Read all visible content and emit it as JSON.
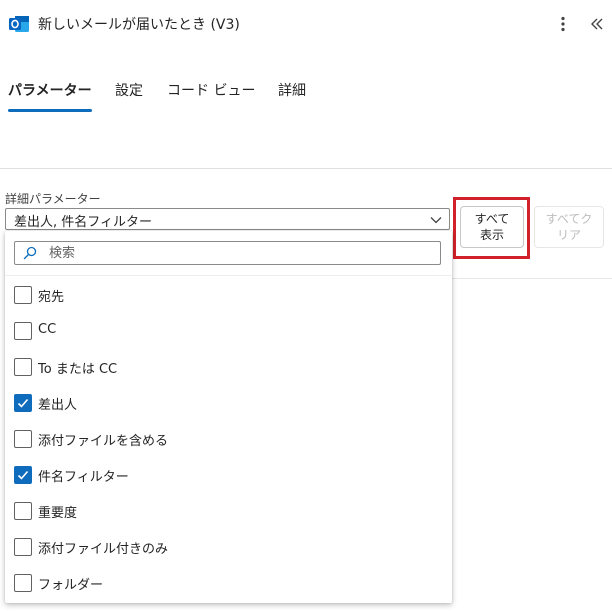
{
  "header": {
    "title": "新しいメールが届いたとき (V3)",
    "app_icon": "outlook-icon",
    "more_icon": "more-vertical-icon",
    "collapse_icon": "double-chevron-left-icon"
  },
  "tabs": [
    {
      "label": "パラメーター",
      "active": true
    },
    {
      "label": "設定",
      "active": false
    },
    {
      "label": "コード ビュー",
      "active": false
    },
    {
      "label": "詳細",
      "active": false
    }
  ],
  "advanced": {
    "label": "詳細パラメーター",
    "selected_value": "差出人, 件名フィルター",
    "show_all_label": "すべて\n表示",
    "clear_all_label": "すべてク\nリア"
  },
  "dropdown": {
    "search_placeholder": "検索",
    "options": [
      {
        "label": "宛先",
        "checked": false
      },
      {
        "label": "CC",
        "checked": false
      },
      {
        "label": "To または CC",
        "checked": false
      },
      {
        "label": "差出人",
        "checked": true
      },
      {
        "label": "添付ファイルを含める",
        "checked": false
      },
      {
        "label": "件名フィルター",
        "checked": true
      },
      {
        "label": "重要度",
        "checked": false
      },
      {
        "label": "添付ファイル付きのみ",
        "checked": false
      },
      {
        "label": "フォルダー",
        "checked": false
      }
    ]
  },
  "colors": {
    "accent": "#0f6cbd",
    "highlight": "#d1212a",
    "outlook_blue": "#0a64c2"
  }
}
